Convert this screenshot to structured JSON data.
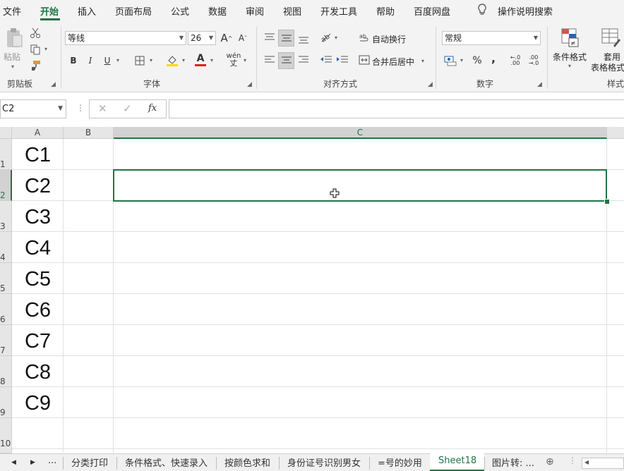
{
  "menu": {
    "items": [
      "文件",
      "开始",
      "插入",
      "页面布局",
      "公式",
      "数据",
      "审阅",
      "视图",
      "开发工具",
      "帮助",
      "百度网盘"
    ],
    "active": "开始",
    "tell_me": "操作说明搜索"
  },
  "ribbon": {
    "clipboard": {
      "paste_label": "粘贴",
      "group_label": "剪贴板"
    },
    "font": {
      "font_name": "等线",
      "font_size": "26",
      "bold": "B",
      "italic": "I",
      "underline": "U",
      "phonetic": "wén",
      "group_label": "字体"
    },
    "alignment": {
      "wrap_text": "自动换行",
      "merge_center": "合并后居中",
      "group_label": "对齐方式"
    },
    "number": {
      "format": "常规",
      "percent": "%",
      "comma": ",",
      "group_label": "数字"
    },
    "styles": {
      "conditional_format": "条件格式",
      "format_table_1": "套用",
      "format_table_2": "表格格式",
      "group_label": "样式"
    }
  },
  "formula_bar": {
    "name_box": "C2",
    "formula": ""
  },
  "columns": [
    "A",
    "B",
    "C"
  ],
  "rows": [
    "1",
    "2",
    "3",
    "4",
    "5",
    "6",
    "7",
    "8",
    "9",
    "10"
  ],
  "cells_A": [
    "C1",
    "C2",
    "C3",
    "C4",
    "C5",
    "C6",
    "C7",
    "C8",
    "C9"
  ],
  "selected_cell": "C2",
  "sheet_tabs": {
    "ellipsis": "...",
    "tabs": [
      "分类打印",
      "条件格式、快速录入",
      "按颜色求和",
      "身份证号识别男女",
      "=号的妙用",
      "Sheet18",
      "图片转: ..."
    ],
    "active": "Sheet18"
  },
  "colors": {
    "accent": "#217346"
  }
}
